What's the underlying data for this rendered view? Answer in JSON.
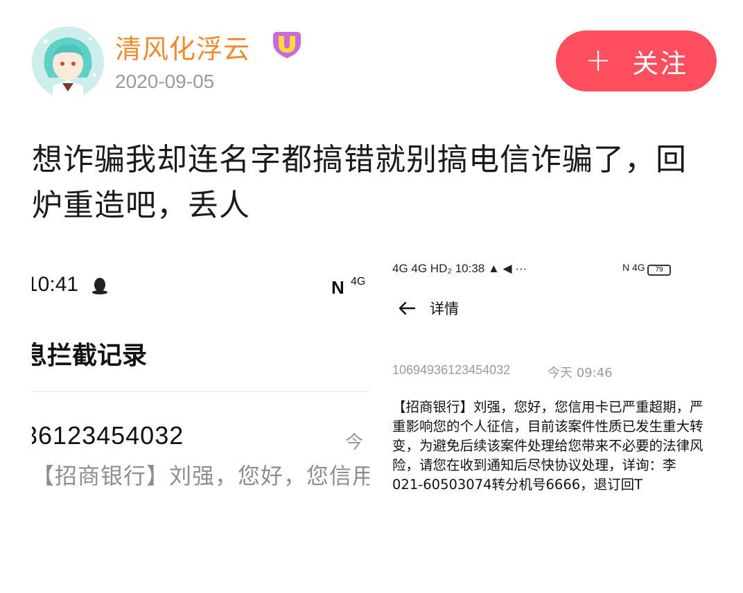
{
  "post": {
    "username": "清风化浮云",
    "date": "2020-09-05",
    "follow_label": "关注",
    "text": "想诈骗我却连名字都搞错就别搞电信诈骗了，回炉重造吧，丢人"
  },
  "screenshot_left": {
    "time": "10:41",
    "network": "4G",
    "title": "息拦截记录",
    "number": "36123454032",
    "today": "今",
    "preview": "【招商银行】刘强，您好，您信用"
  },
  "screenshot_right": {
    "status_time": "10:38",
    "status_left": "4G 4G HD₂",
    "status_icons": "▲ ◀ ···",
    "network": "4G",
    "battery": "79",
    "title": "详情",
    "sender": "10694936123454032",
    "sender_time": "今天 09:46",
    "message": "【招商银行】刘强，您好，您信用卡已严重超期，严重影响您的个人征信，目前该案件性质已发生重大转变，为避免后续该案件处理给您带来不必要的法律风险，请您在收到通知后尽快协议处理，详询：李021-60503074转分机号6666，退订回T"
  },
  "colors": {
    "username": "#f08a2c",
    "follow_button": "#ff4e5e",
    "date": "#9a9a9a"
  }
}
